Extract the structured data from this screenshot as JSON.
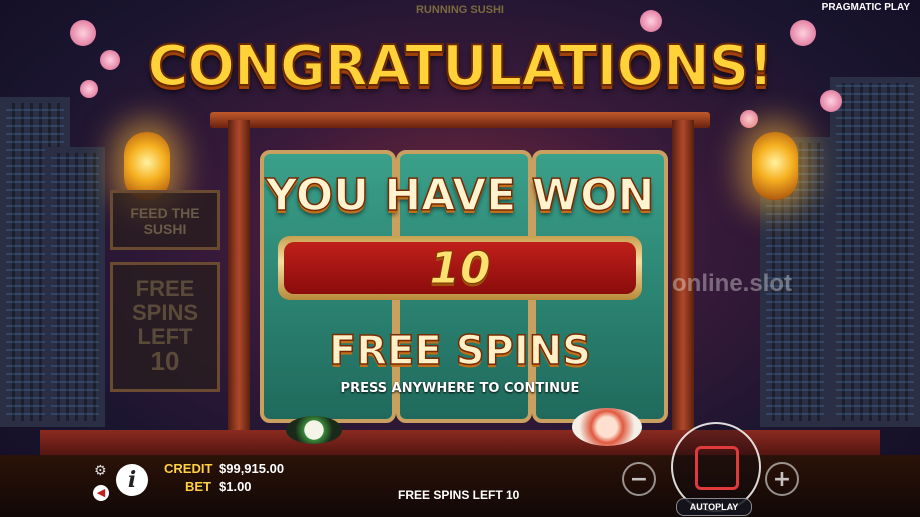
{
  "provider": "PRAGMATIC PLAY",
  "logo_text": "RUNNING SUSHI",
  "watermark": "online.slot",
  "side_panel": {
    "feature_text": "FEED THE SUSHI",
    "free_spins_label_1": "FREE",
    "free_spins_label_2": "SPINS",
    "free_spins_label_3": "LEFT",
    "free_spins_value": "10"
  },
  "popup": {
    "headline": "CONGRATULATIONS!",
    "subheadline": "YOU HAVE WON",
    "count": "10",
    "prize": "FREE SPINS",
    "instruction": "PRESS ANYWHERE TO CONTINUE"
  },
  "hud": {
    "credit_label": "CREDIT",
    "credit_value": "$99,915.00",
    "bet_label": "BET",
    "bet_value": "$1.00",
    "status": "FREE SPINS LEFT 10",
    "autoplay_label": "AUTOPLAY",
    "minus_symbol": "−",
    "plus_symbol": "+",
    "info_symbol": "i"
  },
  "icons": {
    "settings": "gear-icon",
    "sound": "speaker-icon",
    "info": "info-icon",
    "spin": "spin-icon"
  },
  "colors": {
    "accent_gold": "#ffd23a",
    "banner_red": "#a0141a",
    "panel_teal": "#2a8a74",
    "spin_red": "#e03a3a"
  }
}
